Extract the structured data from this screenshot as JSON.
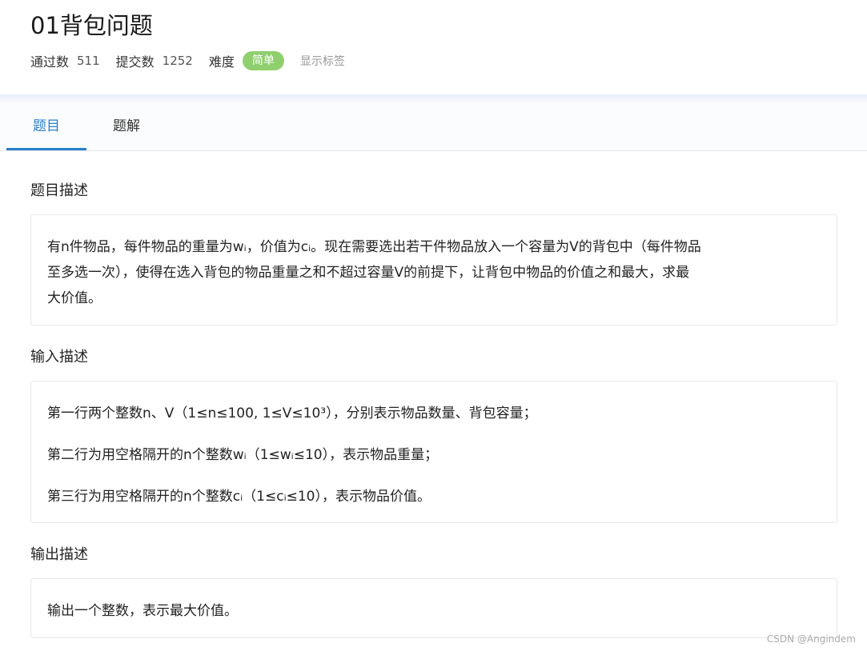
{
  "problem": {
    "title": "01背包问题",
    "pass_label": "通过数",
    "pass_count": "511",
    "submit_label": "提交数",
    "submit_count": "1252",
    "difficulty_label": "难度",
    "difficulty_value": "简单",
    "show_tags": "显示标签"
  },
  "tabs": [
    {
      "label": "题目",
      "active": true
    },
    {
      "label": "题解",
      "active": false
    }
  ],
  "sections": {
    "description": {
      "title": "题目描述",
      "lines": [
        "有n件物品，每件物品的重量为wᵢ，价值为cᵢ。现在需要选出若干件物品放入一个容量为V的背包中（每件物品",
        "至多选一次），使得在选入背包的物品重量之和不超过容量V的前提下，让背包中物品的价值之和最大，求最",
        "大价值。"
      ]
    },
    "input": {
      "title": "输入描述",
      "lines": [
        "第一行两个整数n、V（1≤n≤100, 1≤V≤10³），分别表示物品数量、背包容量；",
        "第二行为用空格隔开的n个整数wᵢ（1≤wᵢ≤10），表示物品重量；",
        "第三行为用空格隔开的n个整数cᵢ（1≤cᵢ≤10），表示物品价值。"
      ]
    },
    "output": {
      "title": "输出描述",
      "lines": [
        "输出一个整数，表示最大价值。"
      ]
    }
  },
  "watermark": "CSDN @Angindem",
  "colors": {
    "accent": "#2a7fcb",
    "badge": "#8fcf6e"
  }
}
